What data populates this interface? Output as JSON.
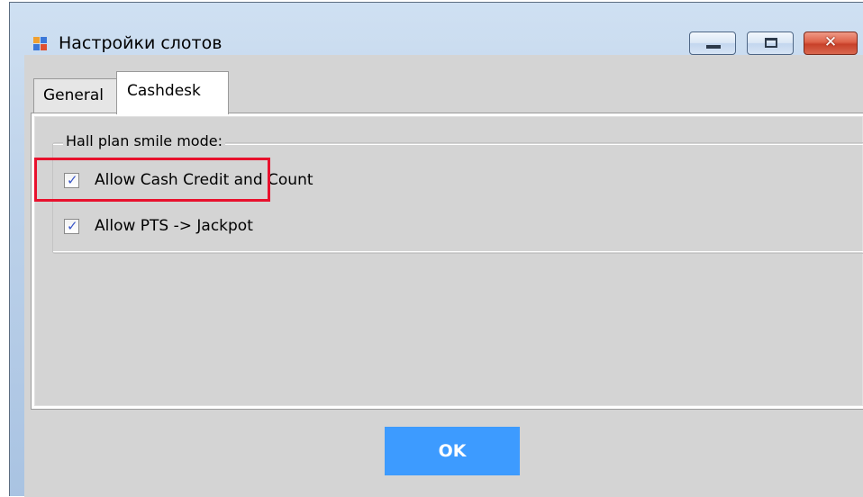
{
  "window": {
    "title": "Настройки слотов",
    "icon": "app-window-icon",
    "controls": {
      "minimize_icon": "minimize-icon",
      "maximize_icon": "maximize-icon",
      "close_glyph": "✕"
    }
  },
  "tabs": [
    {
      "label": "General",
      "active": false
    },
    {
      "label": "Cashdesk",
      "active": true
    }
  ],
  "panel": {
    "group_title": "Hall plan smile mode:",
    "checkboxes": [
      {
        "label": "Allow Cash Credit and Count",
        "checked": true
      },
      {
        "label": "Allow PTS -> Jackpot",
        "checked": true
      }
    ]
  },
  "footer": {
    "ok_label": "OK"
  },
  "colors": {
    "ok_button": "#3d9bff",
    "highlight_box": "#e8112d",
    "client_background": "#d4d4d4",
    "checkmark": "#3a56c8"
  }
}
